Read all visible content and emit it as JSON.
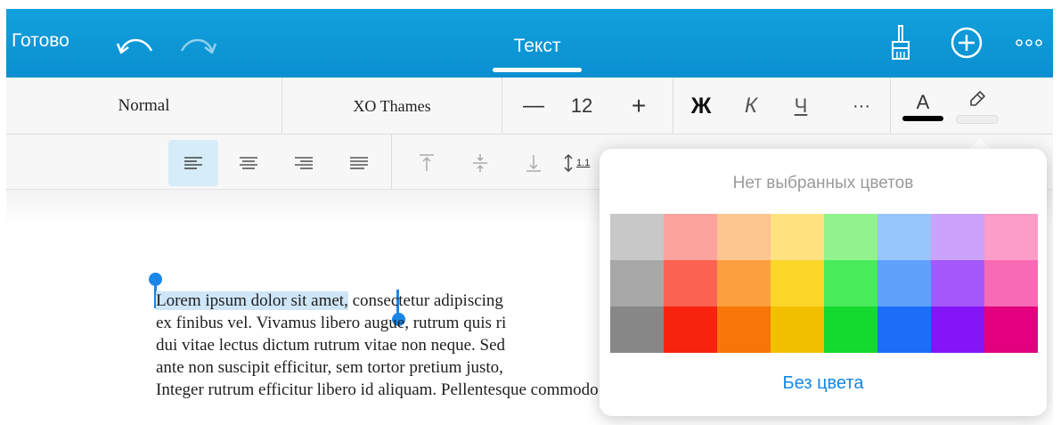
{
  "toolbar": {
    "done_label": "Готово",
    "undo_icon": "undo-icon",
    "redo_icon": "redo-icon",
    "active_tab": "Текст",
    "brush_icon": "format-brush-icon",
    "add_icon": "add-circle-icon",
    "more_icon": "more-dots-icon"
  },
  "format": {
    "paragraph_style": "Normal",
    "font_name": "XO Thames",
    "font_size": "12",
    "decrease_label": "—",
    "increase_label": "+",
    "bold_label": "Ж",
    "italic_label": "К",
    "underline_label": "Ч",
    "more_label": "···",
    "font_color_label": "A",
    "font_color": "#000000"
  },
  "paragraph": {
    "align_options": [
      "align-left",
      "align-center",
      "align-right",
      "align-justify"
    ],
    "active_align": "align-left",
    "vertical_options": [
      "valign-top",
      "valign-middle",
      "valign-bottom"
    ],
    "line_spacing_label": "1.1"
  },
  "document": {
    "selected_text": "Lorem ipsum dolor sit amet,",
    "line1_rest": " consectetur adipiscing",
    "lines": [
      "ex finibus vel. Vivamus libero augue, rutrum quis ri",
      "dui vitae lectus dictum rutrum vitae non neque. Sed",
      "ante non suscipit efficitur, sem tortor pretium justo,",
      "Integer rutrum efficitur libero id aliquam. Pellentesque commodo justo a mauris semper"
    ]
  },
  "color_popover": {
    "title": "Нет выбранных цветов",
    "no_color_label": "Без цвета",
    "swatches": [
      [
        "#c8c8c8",
        "#fda39d",
        "#fdc58f",
        "#fde27f",
        "#91f38d",
        "#97c6fb",
        "#cba2fc",
        "#fb9cc9"
      ],
      [
        "#a8a8a8",
        "#fc6251",
        "#fc9f3f",
        "#fdd62a",
        "#48eb5a",
        "#5fa1fb",
        "#a559fc",
        "#f96ab4"
      ],
      [
        "#878787",
        "#f7230f",
        "#f77608",
        "#f3c000",
        "#14d92f",
        "#1e6df8",
        "#8415f7",
        "#e2007e"
      ]
    ]
  },
  "colors": {
    "accent": "#0a8fd0",
    "selection": "#cfe6f8",
    "link": "#1487e5"
  }
}
